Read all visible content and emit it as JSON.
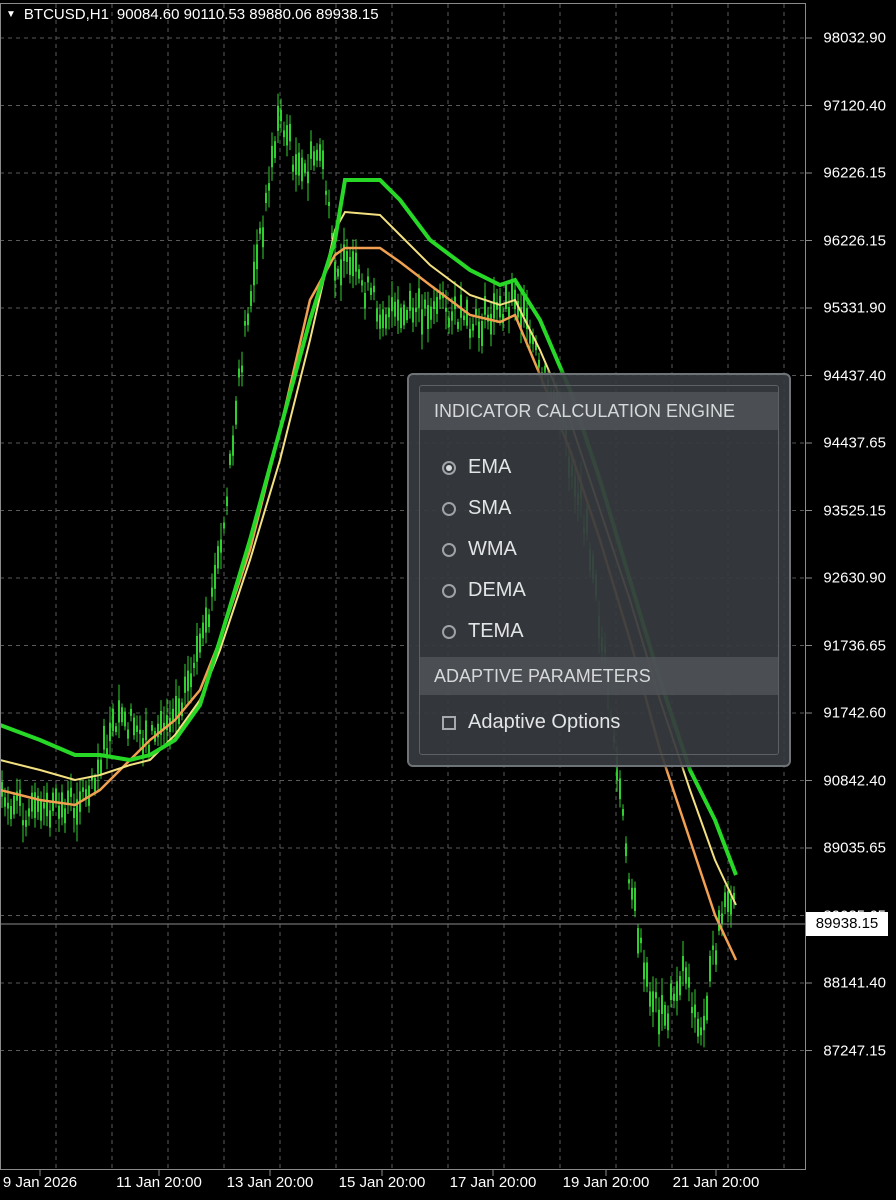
{
  "header": {
    "symbol": "BTCUSD,H1",
    "ohlc": "90084.60 90110.53 89880.06 89938.15"
  },
  "price_axis": [
    "98032.90",
    "97120.40",
    "96226.15",
    "96226.15",
    "95331.90",
    "94437.40",
    "94437.65",
    "93525.15",
    "92630.90",
    "91736.65",
    "91742.60",
    "90842.40",
    "89035.65",
    "89035.65",
    "88141.40",
    "87247.15"
  ],
  "current_price": "89938.15",
  "time_axis": [
    "9 Jan 2026",
    "11 Jan 20:00",
    "13 Jan 20:00",
    "15 Jan 20:00",
    "17 Jan 20:00",
    "19 Jan 20:00",
    "21 Jan 20:00"
  ],
  "colors": {
    "candles": "#2fcf2f",
    "band_outer": "#27d827",
    "band_mid": "#f3e081",
    "band_inner": "#f0a050",
    "grid": "#5a5a5a"
  },
  "panel": {
    "engine_title": "INDICATOR CALCULATION ENGINE",
    "options": [
      {
        "label": "EMA",
        "selected": true
      },
      {
        "label": "SMA",
        "selected": false
      },
      {
        "label": "WMA",
        "selected": false
      },
      {
        "label": "DEMA",
        "selected": false
      },
      {
        "label": "TEMA",
        "selected": false
      }
    ],
    "adaptive_title": "ADAPTIVE PARAMETERS",
    "adaptive_label": "Adaptive Options",
    "adaptive_checked": false
  }
}
